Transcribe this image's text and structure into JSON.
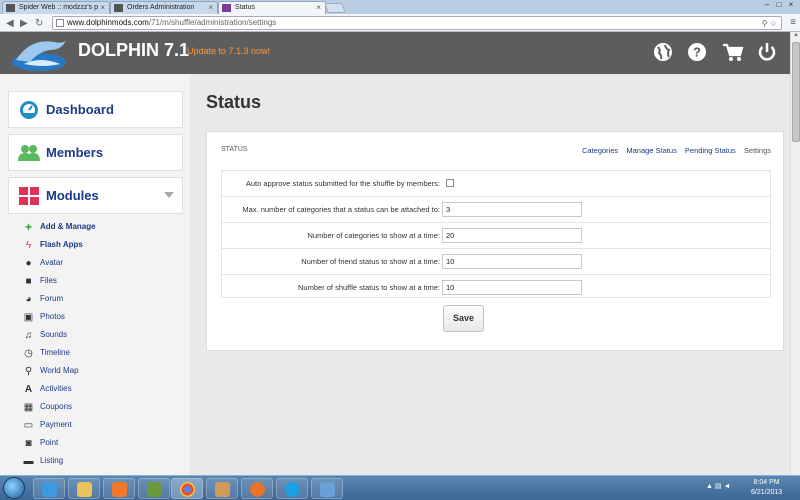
{
  "browser": {
    "tabs": [
      {
        "title": "Spider Web :: modzzz's p",
        "active": false
      },
      {
        "title": "Orders Administration",
        "active": false
      },
      {
        "title": "Status",
        "active": true
      }
    ],
    "url_host": "www.dolphinmods.com",
    "url_path": "/71/m/shuffle/administration/settings"
  },
  "header": {
    "brand": "DOLPHIN 7.1",
    "update_link": "Update to 7.1.3 now!",
    "icons": [
      "globe-icon",
      "help-icon",
      "cart-icon",
      "power-icon"
    ]
  },
  "sidebar": {
    "cards": [
      {
        "label": "Dashboard",
        "icon": "gauge-icon",
        "color": "#1e8fc9"
      },
      {
        "label": "Members",
        "icon": "users-icon",
        "color": "#5cb85c"
      },
      {
        "label": "Modules",
        "icon": "grid-icon",
        "color": "#e0335a"
      }
    ],
    "modules": [
      {
        "label": "Add & Manage",
        "icon": "plus-icon",
        "bold": true
      },
      {
        "label": "Flash Apps",
        "icon": "bolt-icon",
        "bold": true
      },
      {
        "label": "Avatar",
        "icon": "user-icon",
        "bold": false
      },
      {
        "label": "Files",
        "icon": "disk-icon",
        "bold": false
      },
      {
        "label": "Forum",
        "icon": "comments-icon",
        "bold": false
      },
      {
        "label": "Photos",
        "icon": "picture-icon",
        "bold": false
      },
      {
        "label": "Sounds",
        "icon": "music-icon",
        "bold": false
      },
      {
        "label": "Timeline",
        "icon": "clock-icon",
        "bold": false
      },
      {
        "label": "World Map",
        "icon": "map-marker-icon",
        "bold": false
      },
      {
        "label": "Activities",
        "icon": "activity-icon",
        "bold": false
      },
      {
        "label": "Coupons",
        "icon": "qrcode-icon",
        "bold": false
      },
      {
        "label": "Payment",
        "icon": "card-icon",
        "bold": false
      },
      {
        "label": "Point",
        "icon": "point-icon",
        "bold": false
      },
      {
        "label": "Listing",
        "icon": "briefcase-icon",
        "bold": false
      }
    ]
  },
  "main": {
    "title": "Status",
    "panel_title": "STATUS",
    "tabs": [
      "Categories",
      "Manage Status",
      "Pending Status",
      "Settings"
    ],
    "current_tab": "Settings",
    "fields": [
      {
        "label": "Auto approve status submitted for the shuffle by members:",
        "type": "checkbox",
        "value": ""
      },
      {
        "label": "Max. number of categories that a status can be attached to:",
        "type": "text",
        "value": "3"
      },
      {
        "label": "Number of categories to show at a time:",
        "type": "text",
        "value": "20"
      },
      {
        "label": "Number of friend status to show at a time:",
        "type": "text",
        "value": "10"
      },
      {
        "label": "Number of shuffle status to show at a time:",
        "type": "text",
        "value": "10"
      }
    ],
    "save_label": "Save"
  },
  "taskbar": {
    "time": "8:04 PM",
    "date": "6/21/2013"
  }
}
